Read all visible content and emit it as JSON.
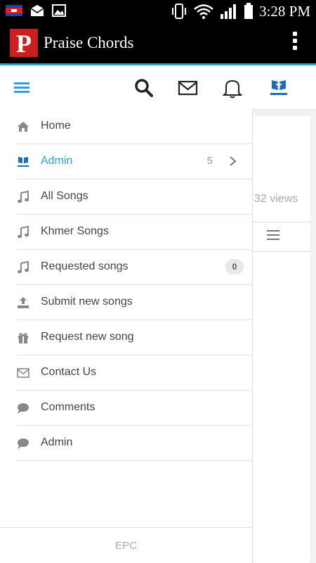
{
  "status_bar": {
    "time": "3:28 PM",
    "icons": [
      "flag-icon",
      "mail-notification-icon",
      "image-notification-icon",
      "vibrate-icon",
      "wifi-icon",
      "signal-icon",
      "battery-icon"
    ]
  },
  "app_bar": {
    "logo_letter": "P",
    "title": "Praise Chords",
    "brand_color": "#cc1f1f",
    "accent_color": "#2f9fd8"
  },
  "toolbar": {
    "icons": [
      "hamburger-menu-icon",
      "search-icon",
      "mail-icon",
      "bell-icon",
      "khmer-praise-logo-icon"
    ]
  },
  "content": {
    "views_text": "32 views"
  },
  "drawer": {
    "items": [
      {
        "label": "Home",
        "icon": "home-icon"
      },
      {
        "label": "Admin",
        "icon": "khmer-praise-logo-icon",
        "count": "5",
        "active": true
      },
      {
        "label": "All Songs",
        "icon": "music-note-icon"
      },
      {
        "label": "Khmer Songs",
        "icon": "music-note-icon"
      },
      {
        "label": "Requested songs",
        "icon": "music-note-icon",
        "badge": "0"
      },
      {
        "label": "Submit new songs",
        "icon": "upload-icon"
      },
      {
        "label": "Request new song",
        "icon": "gift-icon"
      },
      {
        "label": "Contact Us",
        "icon": "envelope-icon"
      },
      {
        "label": "Comments",
        "icon": "comment-icon"
      },
      {
        "label": "Admin",
        "icon": "comment-icon"
      }
    ],
    "footer": "EPC"
  }
}
